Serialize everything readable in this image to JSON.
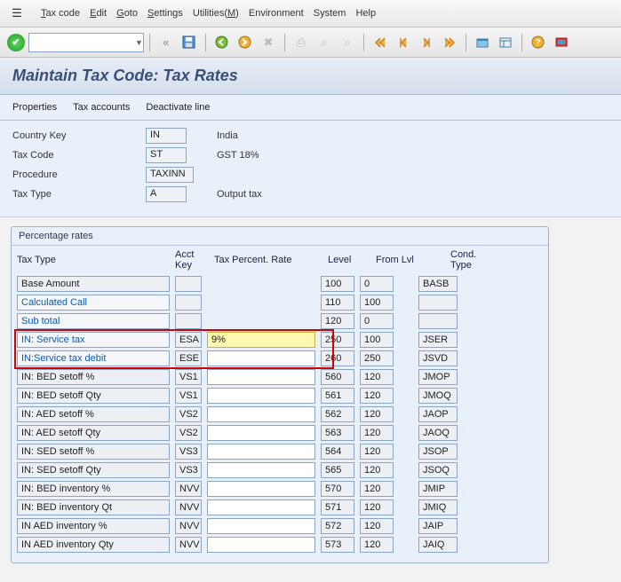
{
  "menubar": {
    "items": [
      {
        "label": "Tax code",
        "u": "T"
      },
      {
        "label": "Edit",
        "u": "E"
      },
      {
        "label": "Goto",
        "u": "G"
      },
      {
        "label": "Settings",
        "u": "S"
      },
      {
        "label": "Utilities(M)",
        "u": ""
      },
      {
        "label": "Environment",
        "u": ""
      },
      {
        "label": "System",
        "u": ""
      },
      {
        "label": "Help",
        "u": ""
      }
    ]
  },
  "title": "Maintain Tax Code: Tax Rates",
  "subtoolbar": [
    "Properties",
    "Tax accounts",
    "Deactivate line"
  ],
  "form": {
    "country_key_label": "Country Key",
    "country_key": "IN",
    "country_key_desc": "India",
    "tax_code_label": "Tax Code",
    "tax_code": "ST",
    "tax_code_desc": "GST 18%",
    "procedure_label": "Procedure",
    "procedure": "TAXINN",
    "tax_type_label": "Tax Type",
    "tax_type": "A",
    "tax_type_desc": "Output tax"
  },
  "rates": {
    "panel_title": "Percentage rates",
    "headers": {
      "type": "Tax Type",
      "key": "Acct Key",
      "rate": "Tax Percent. Rate",
      "level": "Level",
      "from": "From Lvl",
      "cond": "Cond. Type"
    },
    "rows": [
      {
        "type": "Base Amount",
        "link": false,
        "key": "",
        "rate": null,
        "level": "100",
        "from": "0",
        "cond": "BASB"
      },
      {
        "type": "Calculated Call",
        "link": true,
        "key": "",
        "rate": null,
        "level": "110",
        "from": "100",
        "cond": ""
      },
      {
        "type": "Sub total",
        "link": true,
        "key": "",
        "rate": null,
        "level": "120",
        "from": "0",
        "cond": ""
      },
      {
        "type": "IN: Service tax",
        "link": true,
        "key": "ESA",
        "rate": "9%",
        "level": "250",
        "from": "100",
        "cond": "JSER",
        "hl": true
      },
      {
        "type": "IN:Service tax debit",
        "link": true,
        "key": "ESE",
        "rate": "",
        "level": "260",
        "from": "250",
        "cond": "JSVD",
        "hl": true
      },
      {
        "type": "IN: BED setoff %",
        "link": false,
        "key": "VS1",
        "rate": "",
        "level": "560",
        "from": "120",
        "cond": "JMOP"
      },
      {
        "type": "IN: BED setoff Qty",
        "link": false,
        "key": "VS1",
        "rate": "",
        "level": "561",
        "from": "120",
        "cond": "JMOQ"
      },
      {
        "type": "IN: AED setoff %",
        "link": false,
        "key": "VS2",
        "rate": "",
        "level": "562",
        "from": "120",
        "cond": "JAOP"
      },
      {
        "type": "IN: AED setoff Qty",
        "link": false,
        "key": "VS2",
        "rate": "",
        "level": "563",
        "from": "120",
        "cond": "JAOQ"
      },
      {
        "type": "IN: SED setoff %",
        "link": false,
        "key": "VS3",
        "rate": "",
        "level": "564",
        "from": "120",
        "cond": "JSOP"
      },
      {
        "type": "IN: SED setoff Qty",
        "link": false,
        "key": "VS3",
        "rate": "",
        "level": "565",
        "from": "120",
        "cond": "JSOQ"
      },
      {
        "type": "IN: BED inventory %",
        "link": false,
        "key": "NVV",
        "rate": "",
        "level": "570",
        "from": "120",
        "cond": "JMIP"
      },
      {
        "type": "IN: BED inventory Qt",
        "link": false,
        "key": "NVV",
        "rate": "",
        "level": "571",
        "from": "120",
        "cond": "JMIQ"
      },
      {
        "type": "IN AED inventory %",
        "link": false,
        "key": "NVV",
        "rate": "",
        "level": "572",
        "from": "120",
        "cond": "JAIP"
      },
      {
        "type": "IN AED inventory Qty",
        "link": false,
        "key": "NVV",
        "rate": "",
        "level": "573",
        "from": "120",
        "cond": "JAIQ"
      }
    ]
  }
}
